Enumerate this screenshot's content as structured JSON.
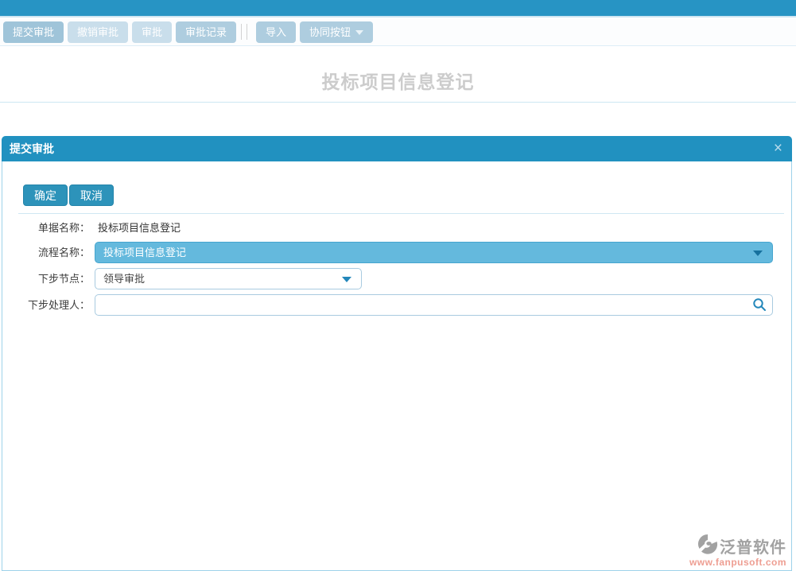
{
  "toolbar": {
    "buttons": [
      {
        "label": "提交审批",
        "state": "primary"
      },
      {
        "label": "撤销审批",
        "state": "disabled"
      },
      {
        "label": "审批",
        "state": "disabled"
      },
      {
        "label": "审批记录",
        "state": "normal"
      },
      {
        "label": "导入",
        "state": "normal"
      },
      {
        "label": "协同按钮",
        "state": "dropdown"
      }
    ]
  },
  "page": {
    "title": "投标项目信息登记"
  },
  "modal": {
    "title": "提交审批",
    "close_glyph": "×",
    "ok_label": "确定",
    "cancel_label": "取消",
    "form": {
      "doc_name": {
        "label": "单据名称：",
        "value": "投标项目信息登记"
      },
      "flow_name": {
        "label": "流程名称：",
        "value": "投标项目信息登记"
      },
      "next_node": {
        "label": "下步节点：",
        "value": "领导审批"
      },
      "next_handler": {
        "label": "下步处理人：",
        "value": ""
      }
    }
  },
  "watermark": {
    "brand": "泛普软件",
    "url": "www.fanpusoft.com"
  },
  "colors": {
    "topbar": "#2794c4",
    "modal_header": "#2191c0",
    "action_button": "#2d93ba",
    "filled_select": "#64b9dd",
    "toolbar_button_primary": "#9fc4d9",
    "toolbar_button_disabled": "#c9deeb",
    "toolbar_button_normal": "#aecddf",
    "dim_title": "#cccccc",
    "watermark_url": "#ee9e92"
  }
}
